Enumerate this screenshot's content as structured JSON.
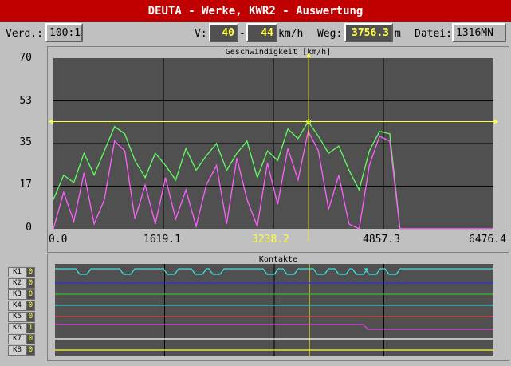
{
  "window": {
    "title": "DEUTA - Werke, KWR2 - Auswertung"
  },
  "header": {
    "verd_label": "Verd.:",
    "verd_value": "100:1",
    "v_label": "V:",
    "v_from": "40",
    "v_sep": "-",
    "v_to": "44",
    "v_unit": "km/h",
    "weg_label": "Weg:",
    "weg_value": "3756.3",
    "weg_unit": "m",
    "datei_label": "Datei:",
    "datei_value": "1316MN"
  },
  "speed_chart": {
    "title": "Geschwindigkeit [km/h]",
    "y_ticks": [
      "70",
      "53",
      "35",
      "17",
      "0"
    ],
    "x_ticks": [
      "0.0",
      "1619.1",
      "3238.2",
      "4857.3",
      "6476.4"
    ],
    "highlight_tick_color": "#ffff40",
    "cursor_color": "#ffff40",
    "series_colors": {
      "green": "#60ff60",
      "magenta": "#ff60ff"
    }
  },
  "chart_data": {
    "type": "line",
    "title": "Geschwindigkeit [km/h]",
    "xlabel": "",
    "ylabel": "",
    "xlim": [
      0,
      6476.4
    ],
    "ylim": [
      0,
      70
    ],
    "cursor_x": 3756.3,
    "cursor_y": 44,
    "series": [
      {
        "x": [
          0,
          150,
          300,
          450,
          600,
          750,
          900,
          1050,
          1200,
          1350,
          1500,
          1650,
          1800,
          1950,
          2100,
          2250,
          2400,
          2550,
          2700,
          2850,
          3000,
          3150,
          3300,
          3450,
          3600,
          3750,
          3900,
          4050,
          4200,
          4350,
          4500,
          4650,
          4800,
          4950,
          5100,
          5400,
          5700,
          6000,
          6476.4
        ],
        "y": [
          12,
          22,
          19,
          31,
          22,
          32,
          42,
          39,
          28,
          21,
          31,
          26,
          20,
          33,
          24,
          30,
          35,
          24,
          31,
          36,
          21,
          32,
          28,
          41,
          37,
          44,
          38,
          31,
          34,
          24,
          16,
          32,
          40,
          39,
          0,
          0,
          0,
          0,
          0
        ]
      },
      {
        "x": [
          0,
          150,
          300,
          450,
          600,
          750,
          900,
          1050,
          1200,
          1350,
          1500,
          1650,
          1800,
          1950,
          2100,
          2250,
          2400,
          2550,
          2700,
          2850,
          3000,
          3150,
          3300,
          3450,
          3600,
          3750,
          3900,
          4050,
          4200,
          4350,
          4500,
          4650,
          4800,
          4950,
          5100,
          5400,
          5700,
          6000,
          6476.4
        ],
        "y": [
          0,
          15,
          3,
          23,
          2,
          12,
          36,
          32,
          4,
          18,
          2,
          21,
          4,
          16,
          1,
          18,
          26,
          2,
          29,
          12,
          1,
          27,
          10,
          33,
          20,
          40,
          32,
          8,
          22,
          2,
          0,
          26,
          38,
          36,
          0,
          0,
          0,
          0,
          0
        ]
      }
    ]
  },
  "contacts": {
    "title": "Kontakte",
    "items": [
      {
        "label": "K1",
        "value": "0",
        "color": "#40e0e0"
      },
      {
        "label": "K2",
        "value": "0",
        "color": "#3030d0"
      },
      {
        "label": "K3",
        "value": "0",
        "color": "#30c030"
      },
      {
        "label": "K4",
        "value": "0",
        "color": "#30c0c0"
      },
      {
        "label": "K5",
        "value": "0",
        "color": "#e04040"
      },
      {
        "label": "K6",
        "value": "1",
        "color": "#e040e0"
      },
      {
        "label": "K7",
        "value": "0",
        "color": "#ffffff"
      },
      {
        "label": "K8",
        "value": "0",
        "color": "#ffff40"
      }
    ]
  }
}
